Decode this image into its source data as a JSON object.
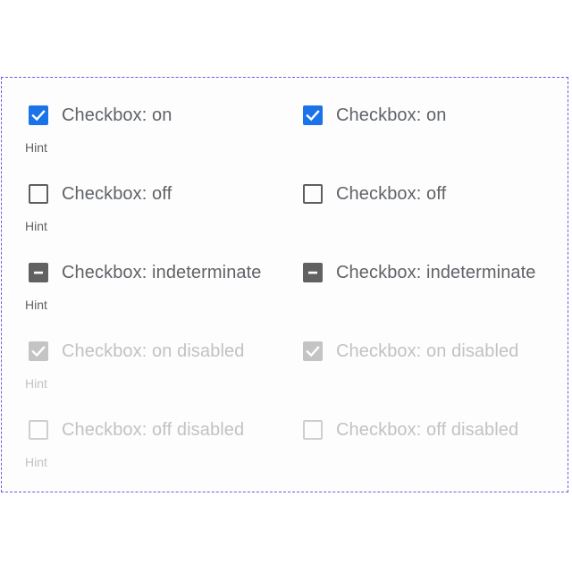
{
  "colors": {
    "accent": "#1a73e8",
    "indeterminate": "#616161",
    "disabled": "#c4c4c4",
    "label": "#5f6368",
    "frame_border": "#6b5ce7"
  },
  "rows": [
    {
      "label": "Checkbox: on",
      "state": "checked",
      "disabled": false,
      "hint": "Hint"
    },
    {
      "label": "Checkbox: off",
      "state": "unchecked",
      "disabled": false,
      "hint": "Hint"
    },
    {
      "label": "Checkbox: indeterminate",
      "state": "indeterminate",
      "disabled": false,
      "hint": "Hint"
    },
    {
      "label": "Checkbox: on disabled",
      "state": "checked",
      "disabled": true,
      "hint": "Hint"
    },
    {
      "label": "Checkbox: off disabled",
      "state": "unchecked",
      "disabled": true,
      "hint": "Hint"
    }
  ],
  "icons": {
    "checked": "check-icon",
    "indeterminate": "minus-icon"
  }
}
